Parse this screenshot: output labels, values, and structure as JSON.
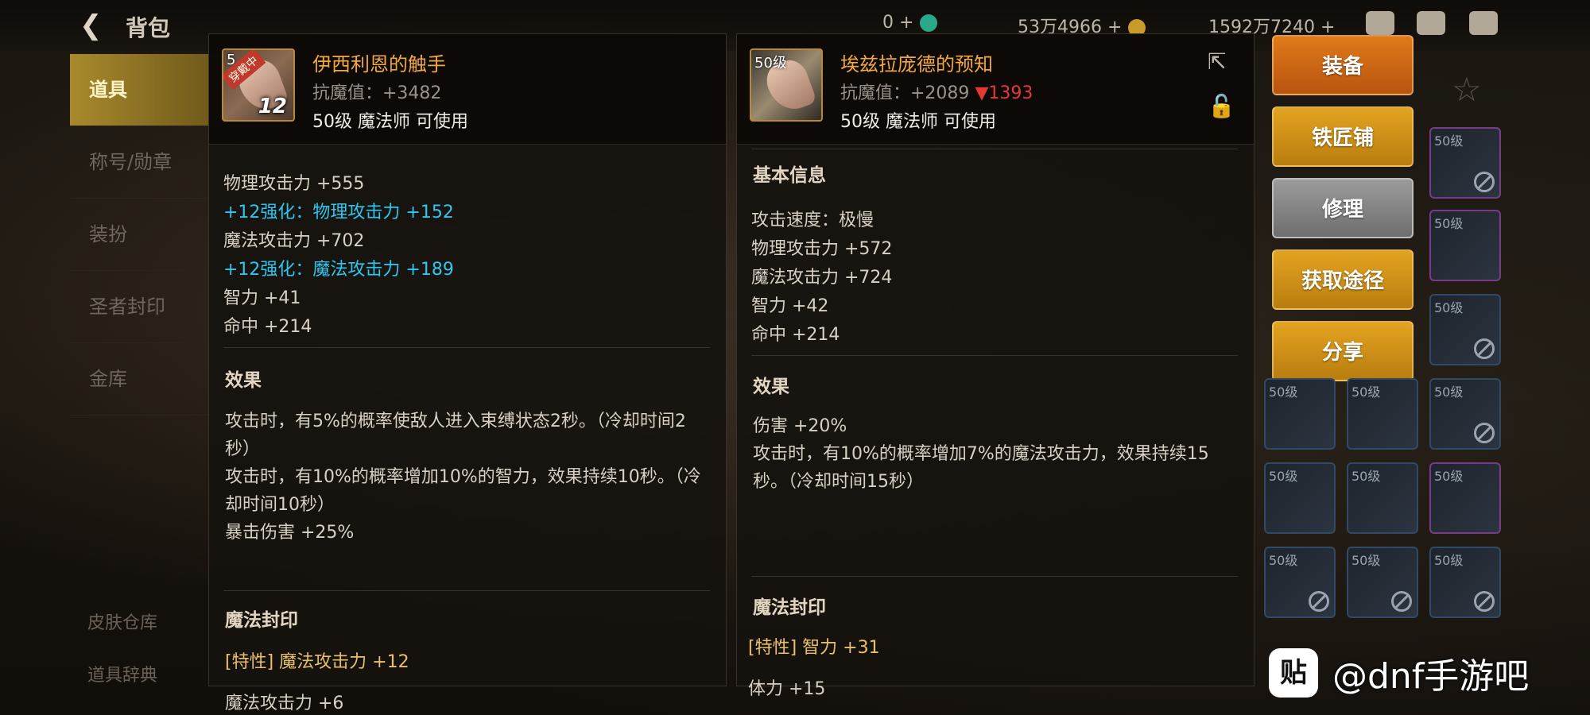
{
  "topbar": {
    "back_icon": "arrow-left-icon",
    "title": "背包",
    "currency1": "0",
    "currency2": "53万4966",
    "currency3": "1592万7240"
  },
  "nav": {
    "items": [
      "道具",
      "称号/勋章",
      "装扮",
      "圣者封印",
      "金库"
    ],
    "bottom": [
      "皮肤仓库",
      "道具辞典"
    ]
  },
  "left_item": {
    "level_badge": "5",
    "worn_tag": "穿戴中",
    "enhance": "12",
    "name": "伊西利恩的触手",
    "stat": "抗魔值：+3482",
    "requirement": "50级 魔法师 可使用",
    "lines": [
      "物理攻击力 +555",
      "+12强化：物理攻击力 +152",
      "魔法攻击力 +702",
      "+12强化：魔法攻击力 +189",
      "智力 +41",
      "命中 +214"
    ],
    "effect_title": "效果",
    "effect_text": [
      "攻击时，有5%的概率使敌人进入束缚状态2秒。（冷却时间2秒）",
      "攻击时，有10%的概率增加10%的智力，效果持续10秒。（冷却时间10秒）",
      "暴击伤害 +25%"
    ],
    "seal_title": "魔法封印",
    "seal_trait": "[特性] 魔法攻击力 +12",
    "seal_extra": "魔法攻击力 +6"
  },
  "right_item": {
    "level_badge": "50级",
    "name": "埃兹拉庞德的预知",
    "stat_prefix": "抗魔值：+2089",
    "stat_diff": "▼1393",
    "requirement": "50级 魔法师 可使用",
    "basic_title": "基本信息",
    "lines": [
      "攻击速度：极慢",
      "物理攻击力 +572",
      "魔法攻击力 +724",
      "智力 +42",
      "命中 +214"
    ],
    "effect_title": "效果",
    "effect_text": [
      "伤害 +20%",
      "攻击时，有10%的概率增加7%的魔法攻击力，效果持续15秒。（冷却时间15秒）"
    ],
    "seal_title": "魔法封印",
    "seal_trait": "[特性] 智力 +31",
    "seal_extra": "体力 +15"
  },
  "buttons": {
    "equip": "装备",
    "smith": "铁匠铺",
    "repair": "修理",
    "source": "获取途径",
    "share": "分享"
  },
  "grid": {
    "slot_label": "50级"
  },
  "watermark": {
    "logo": "贴",
    "text": "@dnf手游吧"
  },
  "colors": {
    "accent_orange": "#e07a1a",
    "accent_gold": "#e3a321",
    "name_gold": "#f2a93a",
    "enhance_cyan": "#2ec7f0",
    "decrease_red": "#e53935"
  }
}
